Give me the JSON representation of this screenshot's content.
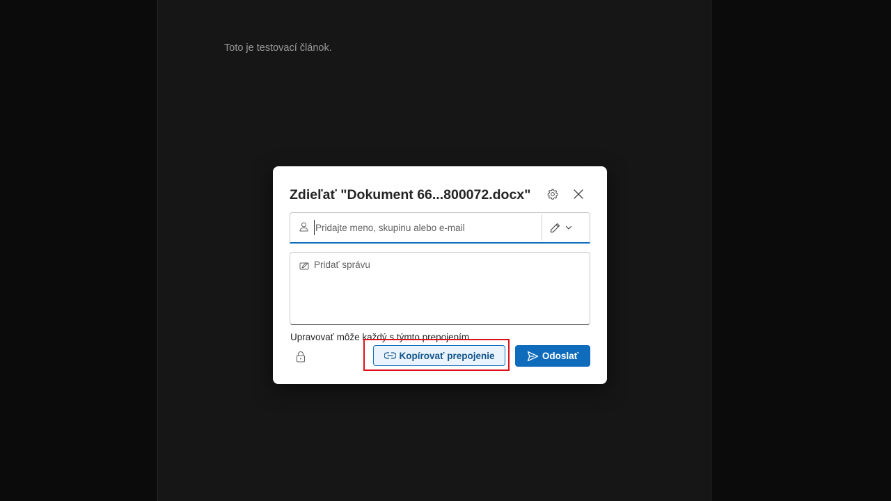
{
  "document": {
    "body_text": "Toto je testovací článok."
  },
  "share_dialog": {
    "title": "Zdieľať \"Dokument 66...800072.docx\"",
    "people_input": {
      "placeholder": "Pridajte meno, skupinu alebo e-mail",
      "value": ""
    },
    "message_input": {
      "placeholder": "Pridať správu",
      "value": ""
    },
    "link_settings_text": "Upravovať môže každý s týmto prepojením.",
    "copy_link_label": "Kopírovať prepojenie",
    "send_label": "Odoslať",
    "icons": {
      "settings": "gear-icon",
      "close": "close-icon",
      "person": "person-icon",
      "permission": "pencil-icon",
      "permission_dropdown": "chevron-down-icon",
      "message": "edit-message-icon",
      "lock": "lock-icon",
      "link": "link-icon",
      "send": "send-icon"
    },
    "colors": {
      "accent": "#0f6cbd",
      "highlight": "#e0101a"
    }
  }
}
